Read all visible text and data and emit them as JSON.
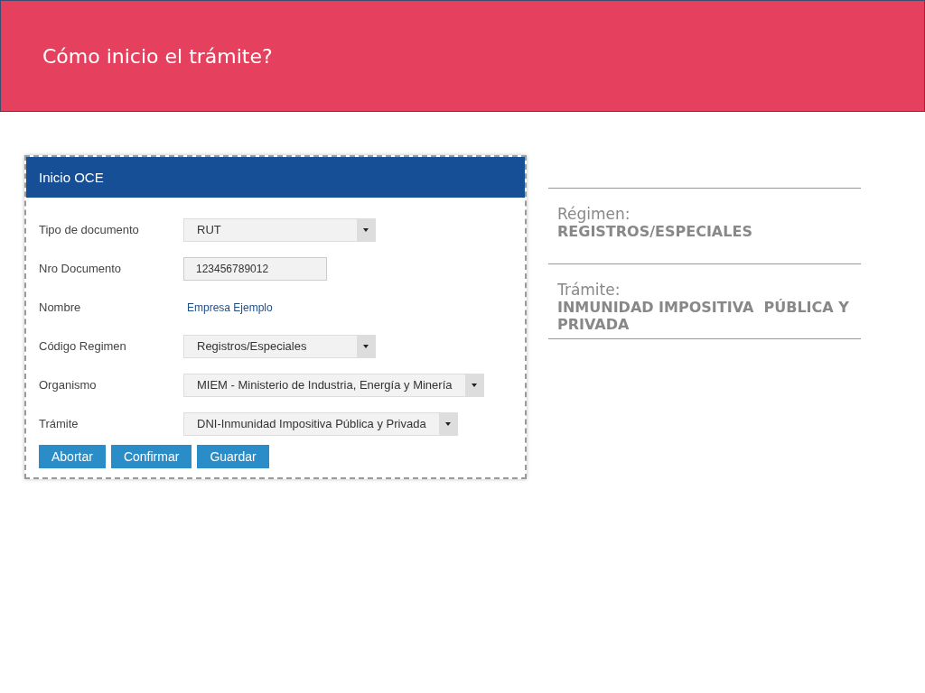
{
  "slide_title": "Cómo inicio el trámite?",
  "form": {
    "title": "Inicio OCE",
    "fields": [
      {
        "label": "Tipo de documento",
        "kind": "select",
        "value": "RUT"
      },
      {
        "label": "Nro Documento",
        "kind": "input",
        "value": "123456789012"
      },
      {
        "label": "Nombre",
        "kind": "text",
        "value": "Empresa Ejemplo"
      },
      {
        "label": "Código Regimen",
        "kind": "select",
        "value": "Registros/Especiales"
      },
      {
        "label": "Organismo",
        "kind": "select",
        "value": "MIEM - Ministerio de Industria, Energía y Minería"
      },
      {
        "label": "Trámite",
        "kind": "select",
        "value": "DNI-Inmunidad Impositiva Pública y Privada"
      }
    ],
    "buttons": [
      "Abortar",
      "Confirmar",
      "Guardar"
    ]
  },
  "summary": [
    {
      "label": "Régimen:",
      "value": "REGISTROS/ESPECIALES"
    },
    {
      "label": "Trámite:",
      "value": "INMUNIDAD IMPOSITIVA  PÚBLICA Y PRIVADA"
    }
  ]
}
